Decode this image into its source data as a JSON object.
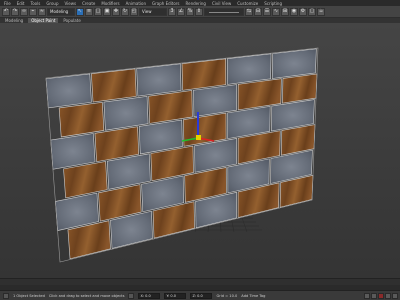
{
  "menubar": {
    "items": [
      "File",
      "Edit",
      "Tools",
      "Group",
      "Views",
      "Create",
      "Modifiers",
      "Animation",
      "Graph Editors",
      "Rendering",
      "Civil View",
      "Customize",
      "Scripting"
    ]
  },
  "toolbar": {
    "view_dropdown": "View",
    "selection_set": "",
    "icons": [
      "undo-icon",
      "redo-icon",
      "link-icon",
      "unlink-icon",
      "bind-icon",
      "filter-icon",
      "select-icon",
      "select-by-name-icon",
      "rect-select-icon",
      "window-crossing-icon",
      "move-icon",
      "rotate-icon",
      "scale-icon",
      "snap-icon",
      "angle-snap-icon",
      "percent-snap-icon",
      "spinner-snap-icon",
      "mirror-icon",
      "align-icon",
      "layer-icon",
      "curve-editor-icon",
      "schematic-icon",
      "material-editor-icon",
      "render-setup-icon",
      "render-frame-icon",
      "render-icon"
    ]
  },
  "tabs": {
    "items": [
      "Modeling",
      "Object Paint",
      "Populate"
    ],
    "active": "Object Paint"
  },
  "viewport": {
    "label": "[+] [Perspective] [Realistic]"
  },
  "status": {
    "left_text": "1 Object Selected",
    "hint": "Click and drag to select and move objects",
    "x": "X: 0.0",
    "y": "Y: 0.0",
    "z": "Z: 0.0",
    "grid": "Grid = 10.0",
    "add_time_tag": "Add Time Tag",
    "auto": "Auto",
    "set_key": "Set Key",
    "selected": "Selected",
    "frame": "0"
  },
  "colors": {
    "wood": "#7a4a23",
    "stone": "#6d7480",
    "grout": "#c9c9c9",
    "background": "#3c3c3c",
    "selection_blue": "#2b6fb6"
  }
}
